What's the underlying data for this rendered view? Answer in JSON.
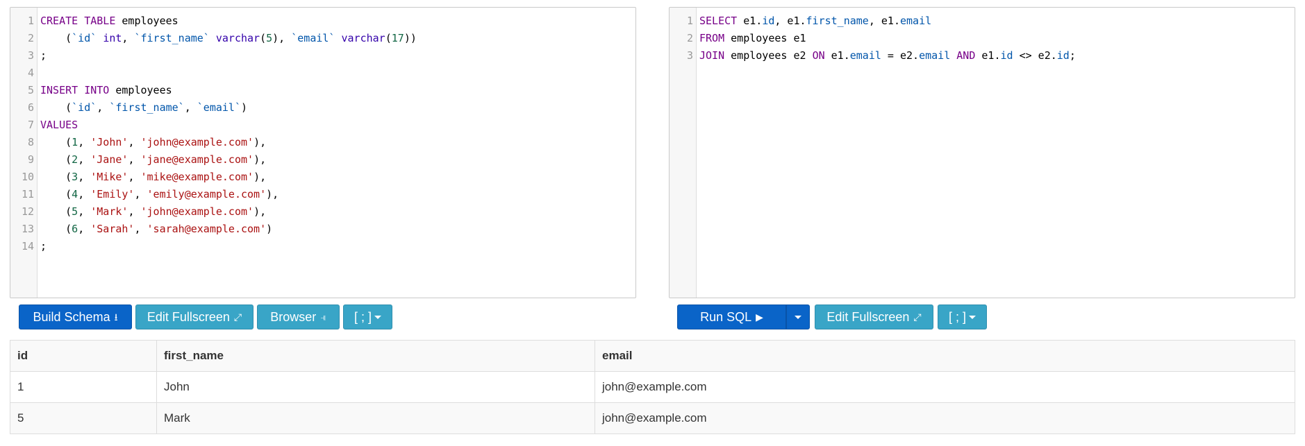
{
  "schema_editor": {
    "lines": [
      {
        "num": "1",
        "tokens": [
          {
            "t": "CREATE TABLE",
            "c": "keyword"
          },
          {
            "t": " employees",
            "c": "ident"
          }
        ]
      },
      {
        "num": "2",
        "tokens": [
          {
            "t": "    (",
            "c": "punct"
          },
          {
            "t": "`id`",
            "c": "field"
          },
          {
            "t": " ",
            "c": "punct"
          },
          {
            "t": "int",
            "c": "builtin"
          },
          {
            "t": ", ",
            "c": "punct"
          },
          {
            "t": "`first_name`",
            "c": "field"
          },
          {
            "t": " ",
            "c": "punct"
          },
          {
            "t": "varchar",
            "c": "builtin"
          },
          {
            "t": "(",
            "c": "punct"
          },
          {
            "t": "5",
            "c": "number"
          },
          {
            "t": "), ",
            "c": "punct"
          },
          {
            "t": "`email`",
            "c": "field"
          },
          {
            "t": " ",
            "c": "punct"
          },
          {
            "t": "varchar",
            "c": "builtin"
          },
          {
            "t": "(",
            "c": "punct"
          },
          {
            "t": "17",
            "c": "number"
          },
          {
            "t": "))",
            "c": "punct"
          }
        ]
      },
      {
        "num": "3",
        "tokens": [
          {
            "t": ";",
            "c": "punct"
          }
        ]
      },
      {
        "num": "4",
        "tokens": []
      },
      {
        "num": "5",
        "tokens": [
          {
            "t": "INSERT INTO",
            "c": "keyword"
          },
          {
            "t": " employees",
            "c": "ident"
          }
        ]
      },
      {
        "num": "6",
        "tokens": [
          {
            "t": "    (",
            "c": "punct"
          },
          {
            "t": "`id`",
            "c": "field"
          },
          {
            "t": ", ",
            "c": "punct"
          },
          {
            "t": "`first_name`",
            "c": "field"
          },
          {
            "t": ", ",
            "c": "punct"
          },
          {
            "t": "`email`",
            "c": "field"
          },
          {
            "t": ")",
            "c": "punct"
          }
        ]
      },
      {
        "num": "7",
        "tokens": [
          {
            "t": "VALUES",
            "c": "keyword"
          }
        ]
      },
      {
        "num": "8",
        "tokens": [
          {
            "t": "    (",
            "c": "punct"
          },
          {
            "t": "1",
            "c": "number"
          },
          {
            "t": ", ",
            "c": "punct"
          },
          {
            "t": "'John'",
            "c": "string"
          },
          {
            "t": ", ",
            "c": "punct"
          },
          {
            "t": "'john@example.com'",
            "c": "string"
          },
          {
            "t": "),",
            "c": "punct"
          }
        ]
      },
      {
        "num": "9",
        "tokens": [
          {
            "t": "    (",
            "c": "punct"
          },
          {
            "t": "2",
            "c": "number"
          },
          {
            "t": ", ",
            "c": "punct"
          },
          {
            "t": "'Jane'",
            "c": "string"
          },
          {
            "t": ", ",
            "c": "punct"
          },
          {
            "t": "'jane@example.com'",
            "c": "string"
          },
          {
            "t": "),",
            "c": "punct"
          }
        ]
      },
      {
        "num": "10",
        "tokens": [
          {
            "t": "    (",
            "c": "punct"
          },
          {
            "t": "3",
            "c": "number"
          },
          {
            "t": ", ",
            "c": "punct"
          },
          {
            "t": "'Mike'",
            "c": "string"
          },
          {
            "t": ", ",
            "c": "punct"
          },
          {
            "t": "'mike@example.com'",
            "c": "string"
          },
          {
            "t": "),",
            "c": "punct"
          }
        ]
      },
      {
        "num": "11",
        "tokens": [
          {
            "t": "    (",
            "c": "punct"
          },
          {
            "t": "4",
            "c": "number"
          },
          {
            "t": ", ",
            "c": "punct"
          },
          {
            "t": "'Emily'",
            "c": "string"
          },
          {
            "t": ", ",
            "c": "punct"
          },
          {
            "t": "'emily@example.com'",
            "c": "string"
          },
          {
            "t": "),",
            "c": "punct"
          }
        ]
      },
      {
        "num": "12",
        "tokens": [
          {
            "t": "    (",
            "c": "punct"
          },
          {
            "t": "5",
            "c": "number"
          },
          {
            "t": ", ",
            "c": "punct"
          },
          {
            "t": "'Mark'",
            "c": "string"
          },
          {
            "t": ", ",
            "c": "punct"
          },
          {
            "t": "'john@example.com'",
            "c": "string"
          },
          {
            "t": "),",
            "c": "punct"
          }
        ]
      },
      {
        "num": "13",
        "tokens": [
          {
            "t": "    (",
            "c": "punct"
          },
          {
            "t": "6",
            "c": "number"
          },
          {
            "t": ", ",
            "c": "punct"
          },
          {
            "t": "'Sarah'",
            "c": "string"
          },
          {
            "t": ", ",
            "c": "punct"
          },
          {
            "t": "'sarah@example.com'",
            "c": "string"
          },
          {
            "t": ")",
            "c": "punct"
          }
        ]
      },
      {
        "num": "14",
        "tokens": [
          {
            "t": ";",
            "c": "punct"
          }
        ]
      }
    ]
  },
  "query_editor": {
    "lines": [
      {
        "num": "1",
        "tokens": [
          {
            "t": "SELECT",
            "c": "keyword"
          },
          {
            "t": " e1.",
            "c": "ident"
          },
          {
            "t": "id",
            "c": "field"
          },
          {
            "t": ", e1.",
            "c": "ident"
          },
          {
            "t": "first_name",
            "c": "field"
          },
          {
            "t": ", e1.",
            "c": "ident"
          },
          {
            "t": "email",
            "c": "field"
          }
        ]
      },
      {
        "num": "2",
        "tokens": [
          {
            "t": "FROM",
            "c": "keyword"
          },
          {
            "t": " employees e1",
            "c": "ident"
          }
        ]
      },
      {
        "num": "3",
        "tokens": [
          {
            "t": "JOIN",
            "c": "keyword"
          },
          {
            "t": " employees e2 ",
            "c": "ident"
          },
          {
            "t": "ON",
            "c": "keyword"
          },
          {
            "t": " e1.",
            "c": "ident"
          },
          {
            "t": "email",
            "c": "field"
          },
          {
            "t": " = e2.",
            "c": "ident"
          },
          {
            "t": "email",
            "c": "field"
          },
          {
            "t": " ",
            "c": "ident"
          },
          {
            "t": "AND",
            "c": "keyword"
          },
          {
            "t": " e1.",
            "c": "ident"
          },
          {
            "t": "id",
            "c": "field"
          },
          {
            "t": " <> e2.",
            "c": "ident"
          },
          {
            "t": "id",
            "c": "field"
          },
          {
            "t": ";",
            "c": "punct"
          }
        ]
      }
    ]
  },
  "schema_toolbar": {
    "build_schema_label": "Build Schema",
    "build_schema_icon": "download-icon",
    "edit_fullscreen_label": "Edit Fullscreen",
    "edit_fullscreen_icon": "expand-icon",
    "browser_label": "Browser",
    "browser_icon": "tree-icon",
    "delimiter_label": "[ ; ]"
  },
  "query_toolbar": {
    "run_sql_label": "Run SQL",
    "run_sql_icon": "play-icon",
    "edit_fullscreen_label": "Edit Fullscreen",
    "edit_fullscreen_icon": "expand-icon",
    "delimiter_label": "[ ; ]"
  },
  "results": {
    "columns": [
      "id",
      "first_name",
      "email"
    ],
    "rows": [
      [
        "1",
        "John",
        "john@example.com"
      ],
      [
        "5",
        "Mark",
        "john@example.com"
      ]
    ]
  },
  "colors": {
    "primary": "#0a64c8",
    "info": "#39a5c7",
    "keyword": "#770088",
    "field": "#0055aa",
    "string": "#aa1111",
    "number": "#116644"
  }
}
